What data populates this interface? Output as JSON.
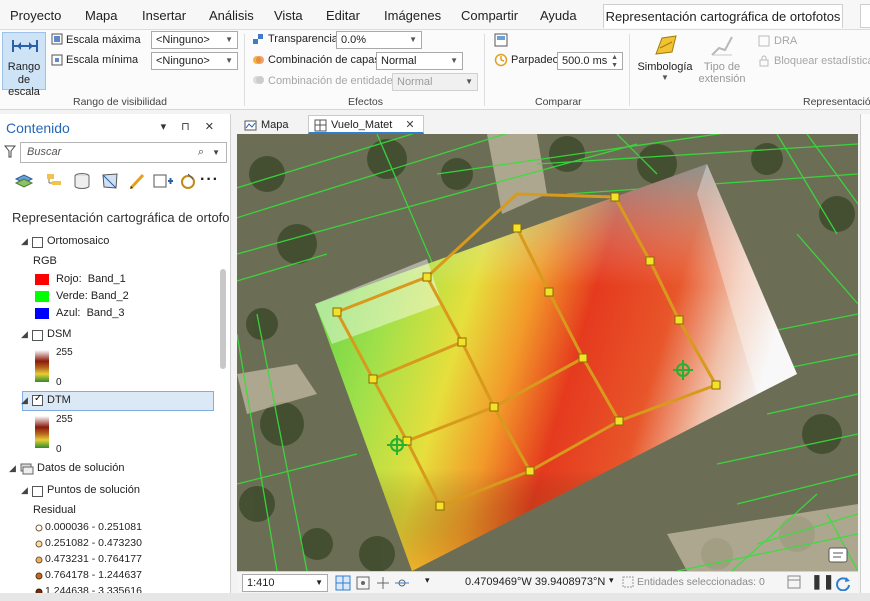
{
  "menu": {
    "items": [
      "Proyecto",
      "Mapa",
      "Insertar",
      "Análisis",
      "Vista",
      "Editar",
      "Imágenes",
      "Compartir",
      "Ayuda"
    ],
    "context_tab": "Representación cartográfica de ortofotos"
  },
  "ribbon": {
    "rango_escala_line1": "Rango",
    "rango_escala_line2": "de escala",
    "escala_maxima_label": "Escala máxima",
    "escala_maxima_value": "<Ninguno>",
    "escala_minima_label": "Escala mínima",
    "escala_minima_value": "<Ninguno>",
    "group_visibility": "Rango de visibilidad",
    "transparencia_label": "Transparencia",
    "transparencia_value": "0.0%",
    "combinacion_capas_label": "Combinación de capas",
    "combinacion_capas_value": "Normal",
    "combinacion_entidades_label": "Combinación de entidades",
    "combinacion_entidades_value": "Normal",
    "group_effects": "Efectos",
    "parpadeo_label": "Parpadeo",
    "parpadeo_value": "500.0",
    "parpadeo_unit": "ms",
    "group_compare": "Comparar",
    "simbologia_label": "Simbología",
    "tipo_extension_line1": "Tipo de",
    "tipo_extension_line2": "extensión",
    "dra_label": "DRA",
    "bloquear_label": "Bloquear estadísticas",
    "group_representation": "Representación"
  },
  "contents": {
    "title": "Contenido",
    "search_placeholder": "Buscar",
    "map_name": "Representación cartográfica de ortofo",
    "layers": {
      "ortomosaico": "Ortomosaico",
      "rgb_label": "RGB",
      "rojo": "Rojo:  Band_1",
      "verde": "Verde: Band_2",
      "azul": "Azul:  Band_3",
      "dsm": "DSM",
      "dsm_max": "255",
      "dsm_min": "0",
      "dtm": "DTM",
      "dtm_max": "255",
      "dtm_min": "0",
      "datos_solucion": "Datos de solución",
      "puntos_solucion": "Puntos de solución",
      "residual_label": "Residual",
      "residual_classes": [
        "0.000036 - 0.251081",
        "0.251082 - 0.473230",
        "0.473231 - 0.764177",
        "0.764178 - 1.244637",
        "1.244638 - 3.335616"
      ]
    },
    "colors": {
      "rojo": "#ff0000",
      "verde": "#00ff00",
      "azul": "#0000ff",
      "selection": "#dbe9f7",
      "title": "#2667b5"
    }
  },
  "map_tabs": [
    "Mapa",
    "Vuelo_Matet"
  ],
  "status": {
    "scale": "1:410",
    "coordinates": "0.4709469°W 39.9408973°N",
    "selected": "Entidades seleccionadas: 0"
  },
  "icons": [
    "filter-icon",
    "search-icon",
    "list-by-drawing-order-icon",
    "list-by-source-icon",
    "list-by-data-icon",
    "list-by-snapping-icon",
    "list-by-editing-icon",
    "list-by-labeling-icon",
    "more-icon",
    "pause-icon",
    "refresh-icon"
  ]
}
